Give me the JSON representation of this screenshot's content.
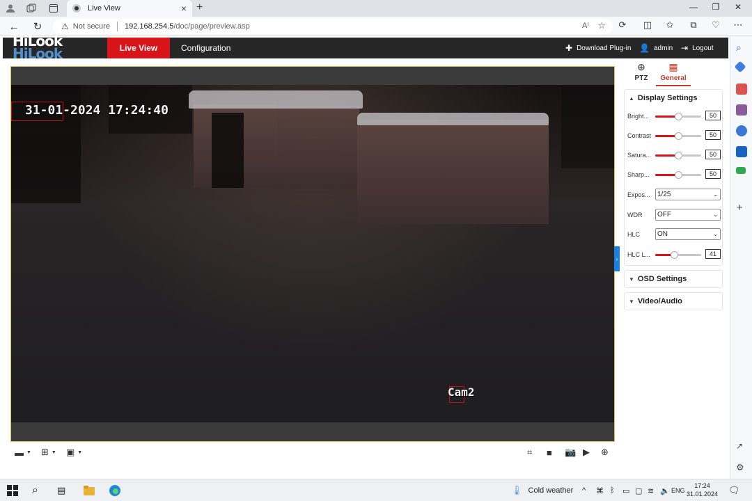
{
  "browser": {
    "tab_title": "Live View",
    "security": "Not secure",
    "url_host": "192.168.254.5",
    "url_path": "/doc/page/preview.asp",
    "new_tab": "+",
    "close_tab": "×"
  },
  "app": {
    "logo_text": "HiLook",
    "nav": {
      "live_view": "Live View",
      "configuration": "Configuration"
    },
    "header": {
      "download_plugin": "Download Plug-in",
      "user": "admin",
      "logout": "Logout"
    }
  },
  "video": {
    "osd_time": "31-01-2024 17:24:40",
    "osd_name": "Cam2"
  },
  "panel": {
    "tabs": {
      "ptz": "PTZ",
      "general": "General"
    },
    "display_settings": {
      "title": "Display Settings",
      "brightness": {
        "label": "Bright...",
        "value": "50",
        "level": 0.5
      },
      "contrast": {
        "label": "Contrast",
        "value": "50",
        "level": 0.5
      },
      "saturation": {
        "label": "Satura...",
        "value": "50",
        "level": 0.5
      },
      "sharpness": {
        "label": "Sharp...",
        "value": "50",
        "level": 0.5
      },
      "exposure": {
        "label": "Expos...",
        "value": "1/25"
      },
      "wdr": {
        "label": "WDR",
        "value": "OFF"
      },
      "hlc": {
        "label": "HLC",
        "value": "ON"
      },
      "hlc_level": {
        "label": "HLC L...",
        "value": "41",
        "level": 0.41
      }
    },
    "osd_settings": "OSD Settings",
    "video_audio": "Video/Audio"
  },
  "taskbar": {
    "weather": "Cold weather",
    "language": "ENG",
    "time": "17:24",
    "date": "31.01.2024"
  },
  "colors": {
    "accent": "#d7141a",
    "header": "#262626",
    "frame_border": "#e4b84a",
    "handle": "#1b80e0"
  }
}
